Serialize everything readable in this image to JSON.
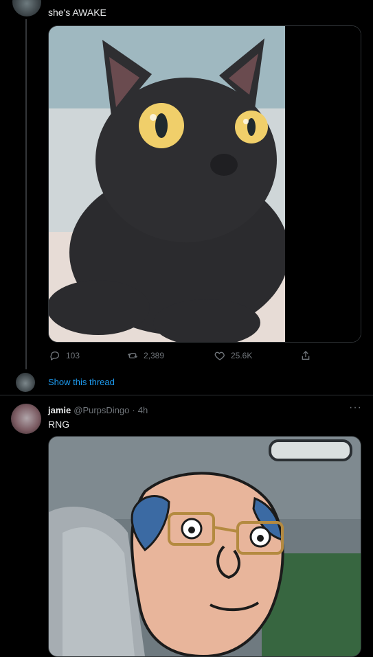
{
  "tweet1": {
    "text": "she's AWAKE",
    "actions": {
      "replies": "103",
      "retweets": "2,389",
      "likes": "25.6K"
    },
    "show_thread": "Show this thread"
  },
  "tweet2": {
    "display_name": "jamie",
    "handle": "@PurpsDingo",
    "separator": "·",
    "time": "4h",
    "text": "RNG",
    "more": "···"
  },
  "icons": [
    "reply-icon",
    "retweet-icon",
    "like-icon",
    "share-icon",
    "more-icon"
  ],
  "colors": {
    "bg": "#000000",
    "text": "#e7e9ea",
    "muted": "#71767b",
    "link": "#1d9bf0",
    "border": "#2f3336"
  }
}
